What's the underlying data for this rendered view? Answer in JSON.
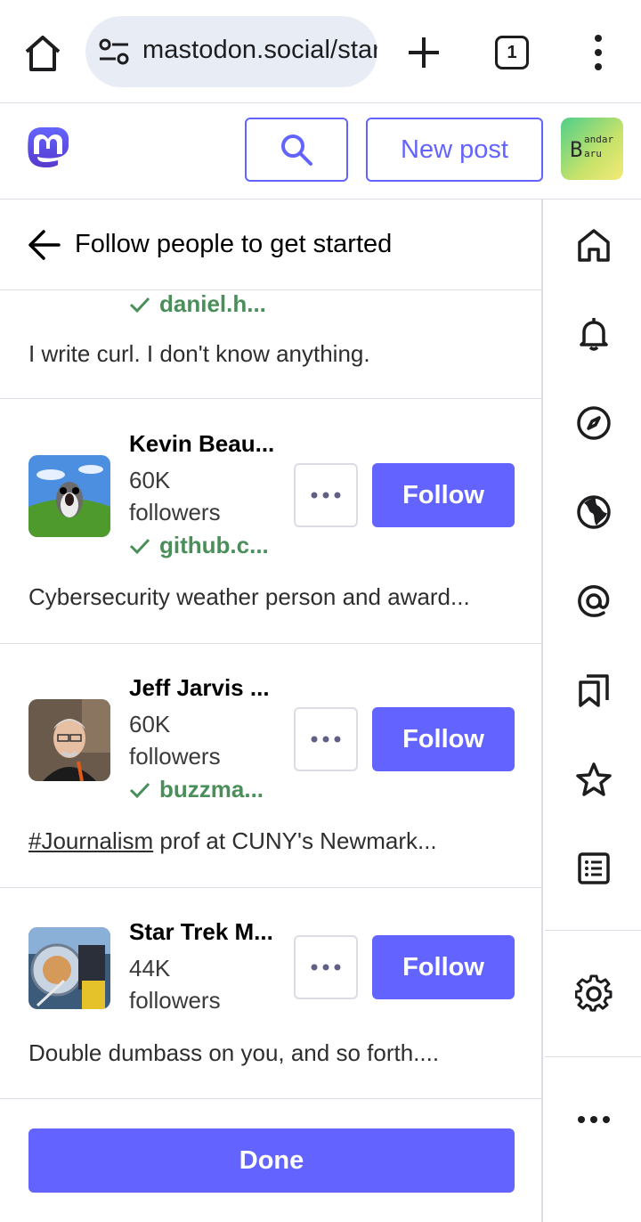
{
  "browser": {
    "url": "mastodon.social/start/follows",
    "tab_count": "1"
  },
  "header": {
    "new_post_label": "New post",
    "avatar_text_big": "B",
    "avatar_text_line1": "andar",
    "avatar_text_line2": "aru"
  },
  "column": {
    "title": "Follow people to get started"
  },
  "accounts": [
    {
      "domain": "daniel.h...",
      "bio": "I write curl. I don't know anything."
    },
    {
      "name": "Kevin Beau...",
      "count": "60K",
      "count_label": "followers",
      "domain": "github.c...",
      "bio": "Cybersecurity weather person and award..."
    },
    {
      "name": "Jeff Jarvis ...",
      "count": "60K",
      "count_label": "followers",
      "domain": "buzzma...",
      "bio_tag": "#Journalism",
      "bio": " prof at CUNY's Newmark..."
    },
    {
      "name": "Star Trek M...",
      "count": "44K",
      "count_label": "followers",
      "bio": "Double dumbass on you, and so forth...."
    }
  ],
  "actions": {
    "follow_label": "Follow",
    "done_label": "Done"
  },
  "colors": {
    "accent": "#6364ff",
    "verified": "#4a8f5a",
    "border": "#dcdce4"
  },
  "icons": {
    "rail": [
      "home-icon",
      "bell-icon",
      "compass-icon",
      "globe-icon",
      "at-icon",
      "bookmarks-icon",
      "star-icon",
      "list-icon",
      "gear-icon",
      "ellipsis-icon"
    ]
  }
}
